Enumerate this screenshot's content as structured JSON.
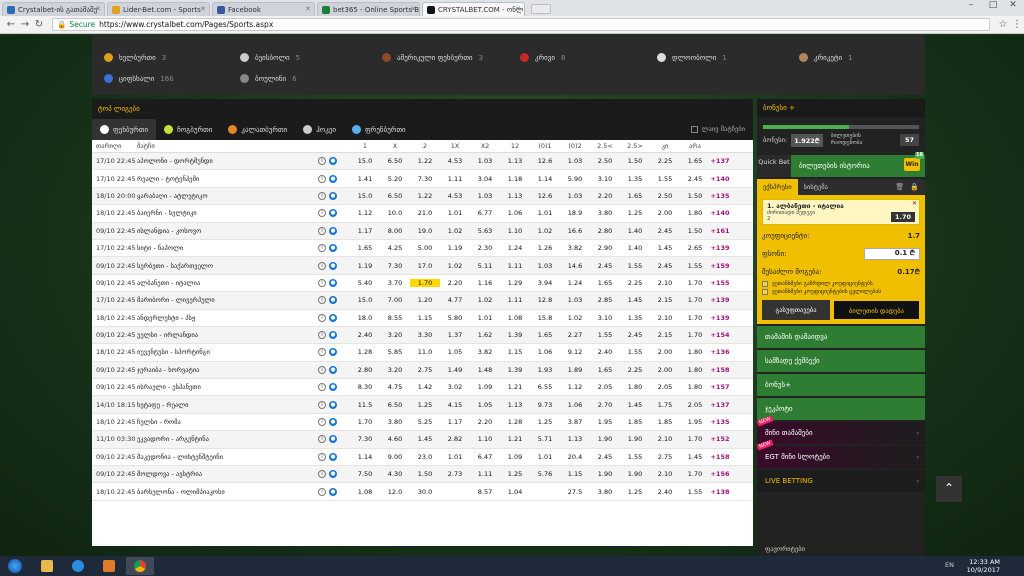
{
  "browser": {
    "tabs": [
      {
        "label": "Crystalbet-ის გათამაშე",
        "color": "#2a6db0",
        "active": false
      },
      {
        "label": "Lider-Bet.com - Sports",
        "color": "#e0a020",
        "active": false
      },
      {
        "label": "Facebook",
        "color": "#3b5998",
        "active": false
      },
      {
        "label": "bet365 - Online Sports B",
        "color": "#1b7f3a",
        "active": false
      },
      {
        "label": "CRYSTALBET.COM - ონლ",
        "color": "#111111",
        "active": true
      }
    ],
    "url_secure": "Secure",
    "url": "https://www.crystalbet.com/Pages/Sports.aspx"
  },
  "sports_grid": [
    {
      "label": "ხელბურთი",
      "count": "3",
      "color": "#d9a020"
    },
    {
      "label": "ბეისბოლი",
      "count": "5",
      "color": "#cccccc"
    },
    {
      "label": "ამერიკული ფეხბურთი",
      "count": "3",
      "color": "#8b4a2a"
    },
    {
      "label": "კრივი",
      "count": "8",
      "color": "#c62828"
    },
    {
      "label": "დლოობოლი",
      "count": "1",
      "color": "#dddddd"
    },
    {
      "label": "კრიკეტი",
      "count": "1",
      "color": "#b0855a"
    },
    {
      "label": "ციფსხალი",
      "count": "166",
      "color": "#3f6fd8"
    },
    {
      "label": "ბოულინი",
      "count": "6",
      "color": "#888888"
    }
  ],
  "top_leagues_label": "ტოპ ლიგები",
  "sport_tabs": [
    "ფეხბურთი",
    "ჩოგბურთი",
    "კალათბურთი",
    "ჰოკეი",
    "ფრენბურთი"
  ],
  "live_only_label": "ლაივ მატჩები",
  "column_headers": {
    "date": "თარიღი",
    "match": "მატჩი",
    "odds": [
      "1",
      "X",
      "2",
      "1X",
      "X2",
      "12",
      "(0)1",
      "(0)2",
      "2.5<",
      "2.5>",
      "კი",
      "არა"
    ]
  },
  "rows": [
    {
      "date": "17/10 22:45",
      "match": "აპოლონი - დორტმუნდი",
      "odds": [
        "15.0",
        "6.50",
        "1.22",
        "4.53",
        "1.03",
        "1.13",
        "12.6",
        "1.03",
        "2.50",
        "1.50",
        "2.25",
        "1.65"
      ],
      "more": "+137"
    },
    {
      "date": "17/10 22:45",
      "match": "რეალი - ტოტენჰემი",
      "odds": [
        "1.41",
        "5.20",
        "7.30",
        "1.11",
        "3.04",
        "1.18",
        "1.14",
        "5.90",
        "3.10",
        "1.35",
        "1.55",
        "2.45"
      ],
      "more": "+140"
    },
    {
      "date": "18/10 20:00",
      "match": "ყარაბაღი - ატლეტიკო",
      "odds": [
        "15.0",
        "6.50",
        "1.22",
        "4.53",
        "1.03",
        "1.13",
        "12.6",
        "1.03",
        "2.20",
        "1.65",
        "2.50",
        "1.50"
      ],
      "more": "+135"
    },
    {
      "date": "18/10 22:45",
      "match": "ბაიერნი - სელტიკი",
      "odds": [
        "1.12",
        "10.0",
        "21.0",
        "1.01",
        "6.77",
        "1.06",
        "1.01",
        "18.9",
        "3.80",
        "1.25",
        "2.00",
        "1.80"
      ],
      "more": "+140"
    },
    {
      "date": "09/10 22:45",
      "match": "ისლანდია - კოსოვო",
      "odds": [
        "1.17",
        "8.00",
        "19.0",
        "1.02",
        "5.63",
        "1.10",
        "1.02",
        "16.6",
        "2.80",
        "1.40",
        "2.45",
        "1.50"
      ],
      "more": "+161"
    },
    {
      "date": "17/10 22:45",
      "match": "სიტი - ნაპოლი",
      "odds": [
        "1.65",
        "4.25",
        "5.00",
        "1.19",
        "2.30",
        "1.24",
        "1.26",
        "3.82",
        "2.90",
        "1.40",
        "1.45",
        "2.65"
      ],
      "more": "+139"
    },
    {
      "date": "09/10 22:45",
      "match": "სერბეთი - საქართველო",
      "odds": [
        "1.19",
        "7.30",
        "17.0",
        "1.02",
        "5.11",
        "1.11",
        "1.03",
        "14.6",
        "2.45",
        "1.55",
        "2.45",
        "1.55"
      ],
      "more": "+159"
    },
    {
      "date": "09/10 22:45",
      "match": "ალბანეთი - იტალია",
      "odds": [
        "5.40",
        "3.70",
        "1.70",
        "2.20",
        "1.16",
        "1.29",
        "3.94",
        "1.24",
        "1.65",
        "2.25",
        "2.10",
        "1.70"
      ],
      "more": "+155",
      "hl": 2
    },
    {
      "date": "17/10 22:45",
      "match": "მარიბორი - ლივერპული",
      "odds": [
        "15.0",
        "7.00",
        "1.20",
        "4.77",
        "1.02",
        "1.11",
        "12.8",
        "1.03",
        "2.85",
        "1.45",
        "2.15",
        "1.70"
      ],
      "more": "+139"
    },
    {
      "date": "18/10 22:45",
      "match": "ანდერლეხტი - პსჟ",
      "odds": [
        "18.0",
        "8.55",
        "1.15",
        "5.80",
        "1.01",
        "1.08",
        "15.8",
        "1.02",
        "3.10",
        "1.35",
        "2.10",
        "1.70"
      ],
      "more": "+139"
    },
    {
      "date": "09/10 22:45",
      "match": "უელსი - ირლანდია",
      "odds": [
        "2.40",
        "3.20",
        "3.30",
        "1.37",
        "1.62",
        "1.39",
        "1.65",
        "2.27",
        "1.55",
        "2.45",
        "2.15",
        "1.70"
      ],
      "more": "+154"
    },
    {
      "date": "18/10 22:45",
      "match": "იუვენტუსი - სპორტინგი",
      "odds": [
        "1.28",
        "5.85",
        "11.0",
        "1.05",
        "3.82",
        "1.15",
        "1.06",
        "9.12",
        "2.40",
        "1.55",
        "2.00",
        "1.80"
      ],
      "more": "+136"
    },
    {
      "date": "09/10 22:45",
      "match": "ჯერაიბა - ხორვატია",
      "odds": [
        "2.80",
        "3.20",
        "2.75",
        "1.49",
        "1.48",
        "1.39",
        "1.93",
        "1.89",
        "1.65",
        "2.25",
        "2.00",
        "1.80"
      ],
      "more": "+158"
    },
    {
      "date": "09/10 22:45",
      "match": "ისრაელი - ესპანეთი",
      "odds": [
        "8.30",
        "4.75",
        "1.42",
        "3.02",
        "1.09",
        "1.21",
        "6.55",
        "1.12",
        "2.05",
        "1.80",
        "2.05",
        "1.80"
      ],
      "more": "+157"
    },
    {
      "date": "14/10 18:15",
      "match": "ხეტაფე - რეალი",
      "odds": [
        "11.5",
        "6.50",
        "1.25",
        "4.15",
        "1.05",
        "1.13",
        "9.73",
        "1.06",
        "2.70",
        "1.45",
        "1.75",
        "2.05"
      ],
      "more": "+137"
    },
    {
      "date": "18/10 22:45",
      "match": "ჩელსი - რომა",
      "odds": [
        "1.70",
        "3.80",
        "5.25",
        "1.17",
        "2.20",
        "1.28",
        "1.25",
        "3.87",
        "1.95",
        "1.85",
        "1.85",
        "1.95"
      ],
      "more": "+135"
    },
    {
      "date": "11/10 03:30",
      "match": "ეკვადორი - არგენტინა",
      "odds": [
        "7.30",
        "4.60",
        "1.45",
        "2.82",
        "1.10",
        "1.21",
        "5.71",
        "1.13",
        "1.90",
        "1.90",
        "2.10",
        "1.70"
      ],
      "more": "+152"
    },
    {
      "date": "09/10 22:45",
      "match": "მაკედონია - ლიხტენშტეინი",
      "odds": [
        "1.14",
        "9.00",
        "23.0",
        "1.01",
        "6.47",
        "1.09",
        "1.01",
        "20.4",
        "2.45",
        "1.55",
        "2.75",
        "1.45"
      ],
      "more": "+158"
    },
    {
      "date": "09/10 22:45",
      "match": "მოლდოვა - ავსტრია",
      "odds": [
        "7.50",
        "4.30",
        "1.50",
        "2.73",
        "1.11",
        "1.25",
        "5.76",
        "1.15",
        "1.90",
        "1.90",
        "2.10",
        "1.70"
      ],
      "more": "+156"
    },
    {
      "date": "18/10 22:45",
      "match": "ბარსელონა - ოლიმპიაკოსი",
      "odds": [
        "1.08",
        "12.0",
        "30.0",
        "",
        "8.57",
        "1.04",
        "",
        "27.5",
        "3.80",
        "1.25",
        "2.40",
        "1.55"
      ],
      "more": "+138"
    }
  ],
  "right": {
    "bonus_title": "ბონუსი +",
    "bonus_progress": 0.55,
    "bonus_label": "ბონუსი:",
    "bonus_value": "1.922₾",
    "points_label": "ბილეთების რაოდენობა",
    "points_value": "57",
    "quick_bet": "Quick Bet",
    "betslip_history": "ბილეთების ისტორია",
    "win_badge": "Win",
    "win_count": "16",
    "tab_single": "ექსპრესი",
    "tab_system": "სისტემა",
    "selection_title": "1. ალბანეთი - იტალია",
    "selection_market": "ძირითადი შედეგი",
    "selection_pick": "2",
    "selection_odds": "1.70",
    "coef_label": "კოეფიციენტი:",
    "coef_value": "1.7",
    "stake_label": "ფსონი:",
    "stake_value": "0.1 ₾",
    "win_label": "შესაძლო მოგება:",
    "win_value": "0.17₾",
    "check1": "ვეთანხმები გაზრდილ კოეფიციენტებს",
    "check2": "ვეთანხმები კოეფიციენტების ცვლილებას",
    "clear_btn": "გასუფთავება",
    "place_btn": "ბილეთის დადება",
    "menu": [
      {
        "label": "თამაშის დაშაიდვა",
        "style": "green"
      },
      {
        "label": "სამზადე ქეშბექი",
        "style": "green"
      },
      {
        "label": "ბონუს+",
        "style": "green"
      },
      {
        "label": "ჯეკპოტი",
        "style": "green"
      },
      {
        "label": "მინი თამაშები",
        "style": "dark",
        "new": "NEW"
      },
      {
        "label": "EGT მინი სლოტები",
        "style": "dark",
        "new": "NEW"
      },
      {
        "label": "LIVE BETTING",
        "style": "live"
      }
    ],
    "favorites": "ფავორიტები"
  },
  "taskbar": {
    "time": "12:33 AM",
    "date": "10/9/2017",
    "lang": "EN"
  }
}
